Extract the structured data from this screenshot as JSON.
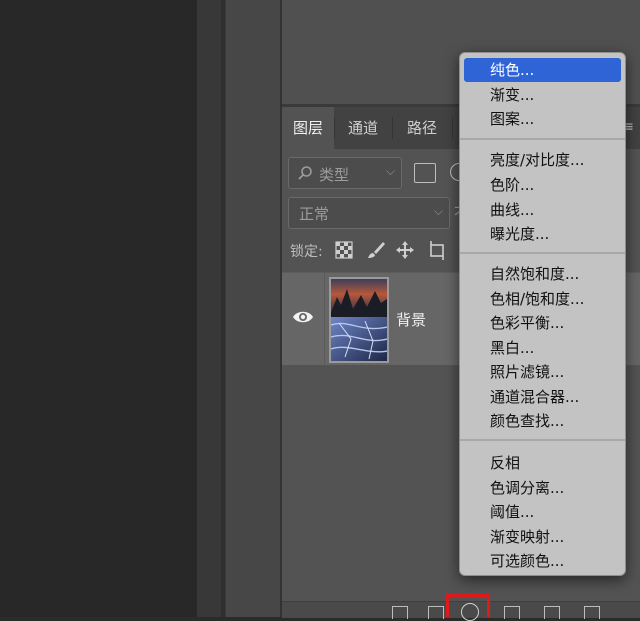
{
  "layers_panel": {
    "tabs": [
      {
        "label": "图层",
        "active": true
      },
      {
        "label": "通道",
        "active": false
      },
      {
        "label": "路径",
        "active": false
      }
    ],
    "filter": {
      "kind_label": "类型"
    },
    "blend_mode": {
      "value": "正常",
      "opacity_fragment": "不"
    },
    "lock": {
      "label": "锁定:"
    },
    "layers": [
      {
        "name": "背景",
        "visible": true
      }
    ]
  },
  "adjustment_menu": {
    "groups": [
      [
        "纯色...",
        "渐变...",
        "图案..."
      ],
      [
        "亮度/对比度...",
        "色阶...",
        "曲线...",
        "曝光度..."
      ],
      [
        "自然饱和度...",
        "色相/饱和度...",
        "色彩平衡...",
        "黑白...",
        "照片滤镜...",
        "通道混合器...",
        "颜色查找..."
      ],
      [
        "反相",
        "色调分离...",
        "阈值...",
        "渐变映射...",
        "可选颜色..."
      ]
    ],
    "selected": "纯色..."
  },
  "colors": {
    "menu_highlight": "#2e64d6",
    "annotation_box": "#e0191c",
    "panel_bg": "#535353"
  }
}
